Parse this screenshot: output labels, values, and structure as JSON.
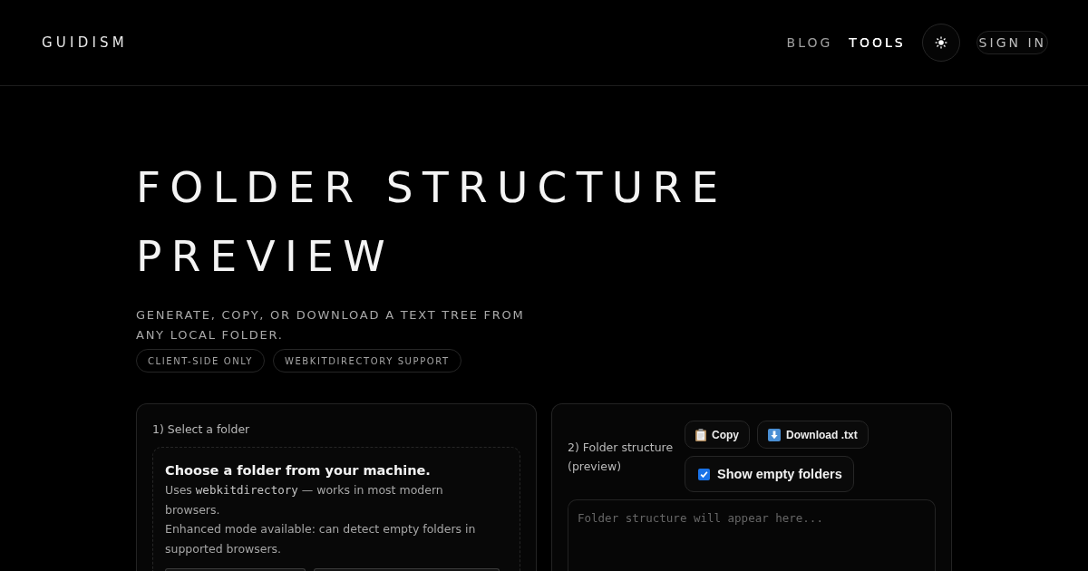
{
  "header": {
    "logo": "GUIDISM",
    "nav": [
      {
        "label": "BLOG",
        "selected": false
      },
      {
        "label": "TOOLS",
        "selected": true
      }
    ],
    "sign_in": "SIGN IN"
  },
  "hero": {
    "title": "FOLDER STRUCTURE PREVIEW",
    "subtitle": "GENERATE, COPY, OR DOWNLOAD A TEXT TREE FROM ANY LOCAL FOLDER.",
    "badges": [
      "CLIENT-SIDE ONLY",
      "WEBKITDIRECTORY SUPPORT"
    ]
  },
  "select_panel": {
    "label": "1) Select a folder",
    "dropzone": {
      "heading": "Choose a folder from your machine.",
      "description": {
        "before": "Uses ",
        "code": "webkitdirectory",
        "after": " — works in most modern browsers."
      },
      "note": "Enhanced mode available: can detect empty folders in supported browsers."
    }
  },
  "preview_panel": {
    "label": "2) Folder structure (preview)",
    "actions": [
      {
        "kind": "copy",
        "label": "Copy"
      },
      {
        "kind": "download",
        "label": "Download .txt"
      }
    ],
    "show_empty_folders": {
      "label": "Show empty folders",
      "checked": true
    },
    "output": {
      "placeholder": "Folder structure will appear here..."
    }
  }
}
